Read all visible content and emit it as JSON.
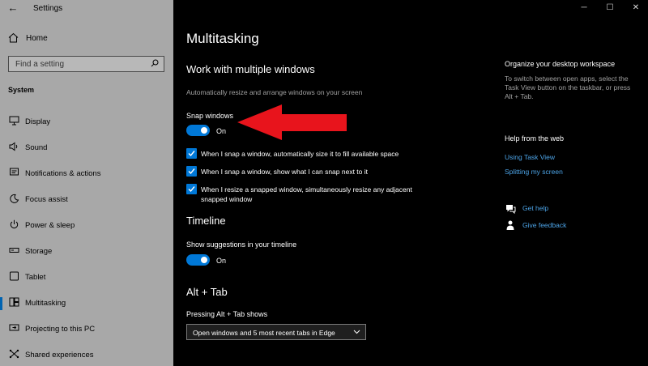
{
  "window": {
    "title": "Settings"
  },
  "sidebar": {
    "home_label": "Home",
    "search_placeholder": "Find a setting",
    "section": "System",
    "items": [
      {
        "label": "Display",
        "icon": "monitor-icon"
      },
      {
        "label": "Sound",
        "icon": "speaker-icon"
      },
      {
        "label": "Notifications & actions",
        "icon": "notification-icon"
      },
      {
        "label": "Focus assist",
        "icon": "moon-icon"
      },
      {
        "label": "Power & sleep",
        "icon": "power-icon"
      },
      {
        "label": "Storage",
        "icon": "storage-icon"
      },
      {
        "label": "Tablet",
        "icon": "tablet-icon"
      },
      {
        "label": "Multitasking",
        "icon": "multitasking-icon",
        "active": true
      },
      {
        "label": "Projecting to this PC",
        "icon": "projecting-icon"
      },
      {
        "label": "Shared experiences",
        "icon": "shared-icon"
      }
    ]
  },
  "main": {
    "title": "Multitasking",
    "snap": {
      "heading": "Work with multiple windows",
      "description": "Automatically resize and arrange windows on your screen",
      "toggle_label": "Snap windows",
      "toggle_state": "On",
      "checkboxes": [
        "When I snap a window, automatically size it to fill available space",
        "When I snap a window, show what I can snap next to it",
        "When I resize a snapped window, simultaneously resize any adjacent snapped window"
      ]
    },
    "timeline": {
      "heading": "Timeline",
      "toggle_label": "Show suggestions in your timeline",
      "toggle_state": "On"
    },
    "alttab": {
      "heading": "Alt + Tab",
      "label": "Pressing Alt + Tab shows",
      "selected": "Open windows and 5 most recent tabs in Edge"
    }
  },
  "right": {
    "organize_heading": "Organize your desktop workspace",
    "organize_text": "To switch between open apps, select the Task View button on the taskbar, or press Alt + Tab.",
    "help_heading": "Help from the web",
    "links": [
      "Using Task View",
      "Splitting my screen"
    ],
    "get_help": "Get help",
    "feedback": "Give feedback"
  },
  "colors": {
    "accent": "#0078d7",
    "link": "#4ca3e6",
    "annotation": "#e8141c",
    "sidebar_bg": "#a8a8a8"
  }
}
